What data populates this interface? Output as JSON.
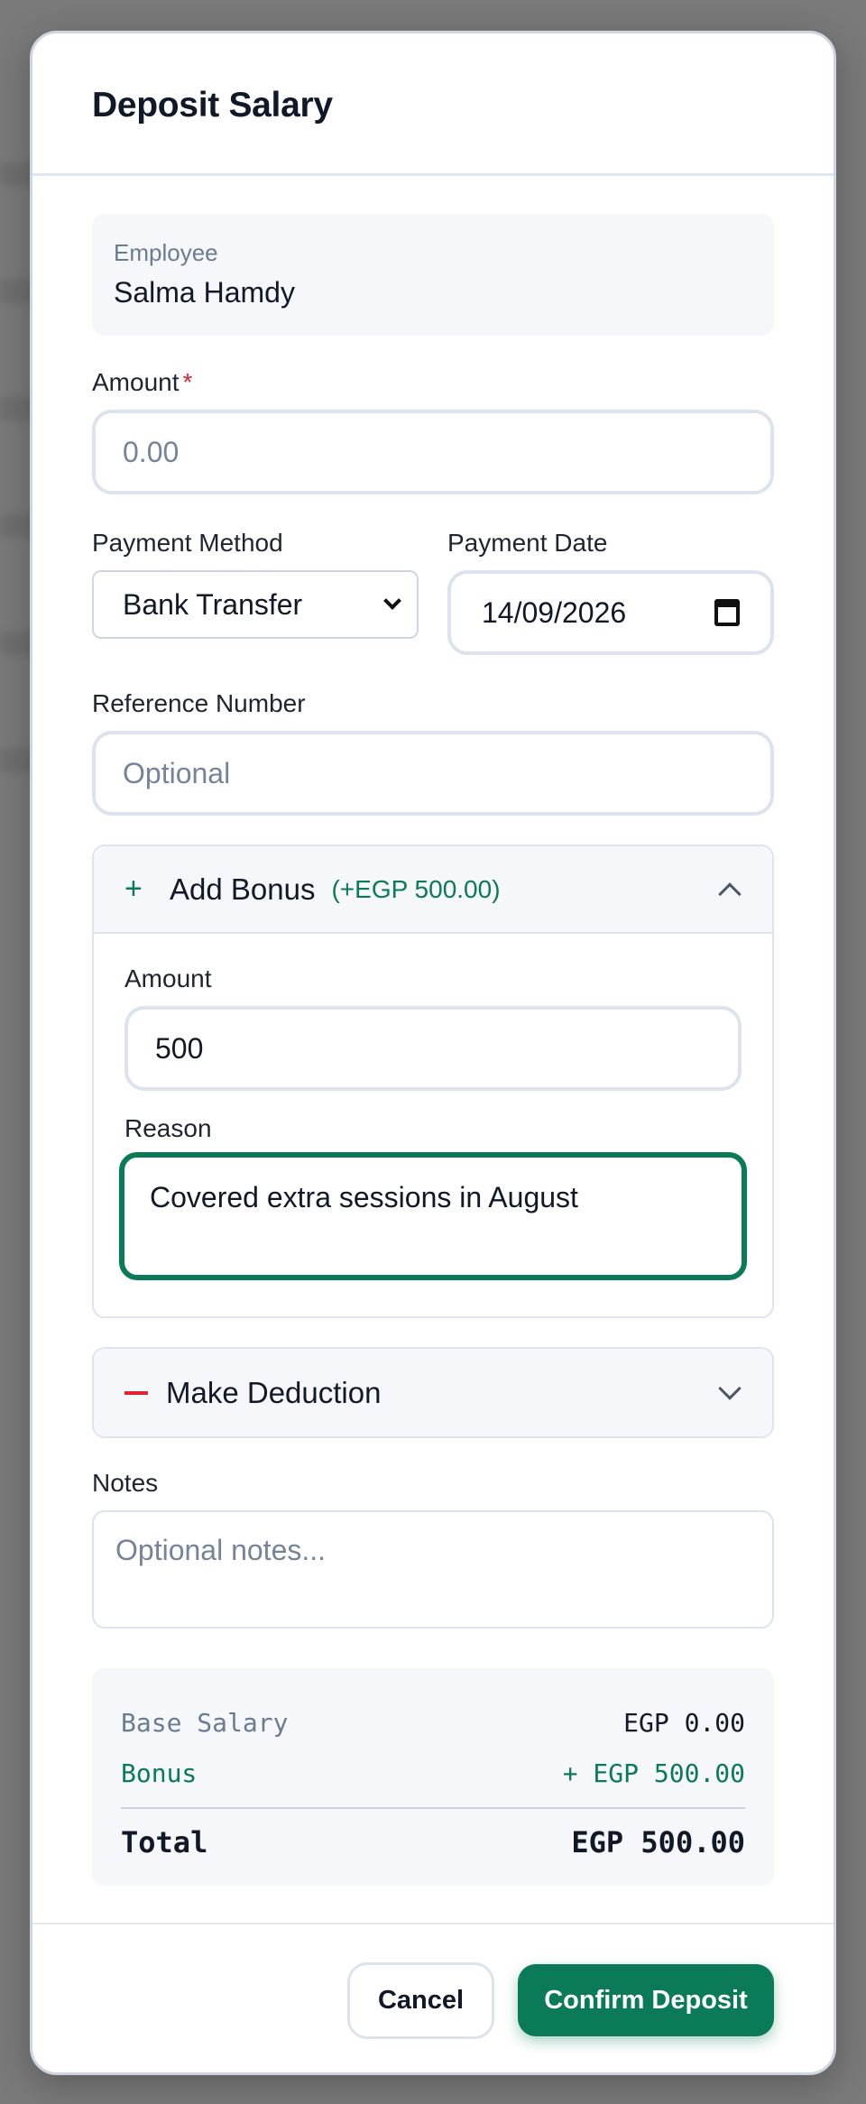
{
  "modal": {
    "title": "Deposit Salary"
  },
  "employee": {
    "label": "Employee",
    "name": "Salma Hamdy"
  },
  "amount": {
    "label": "Amount",
    "required_mark": "*",
    "placeholder": "0.00"
  },
  "payment_method": {
    "label": "Payment Method",
    "selected": "Bank Transfer"
  },
  "payment_date": {
    "label": "Payment Date",
    "value": "14/09/2026"
  },
  "reference": {
    "label": "Reference Number",
    "placeholder": "Optional"
  },
  "bonus": {
    "icon": "plus-icon",
    "title": "Add Bonus",
    "badge": "(+EGP 500.00)",
    "amount_label": "Amount",
    "amount_value": "500",
    "reason_label": "Reason",
    "reason_value": "Covered extra sessions in August",
    "expanded": true
  },
  "deduction": {
    "icon": "minus-icon",
    "title": "Make Deduction",
    "expanded": false
  },
  "notes": {
    "label": "Notes",
    "placeholder": "Optional notes..."
  },
  "summary": {
    "base_label": "Base Salary",
    "base_value": "EGP 0.00",
    "bonus_label": "Bonus",
    "bonus_value": "+ EGP 500.00",
    "total_label": "Total",
    "total_value": "EGP 500.00"
  },
  "footer": {
    "cancel": "Cancel",
    "confirm": "Confirm Deposit"
  },
  "colors": {
    "accent": "#0b7a58",
    "danger": "#e0242f"
  }
}
